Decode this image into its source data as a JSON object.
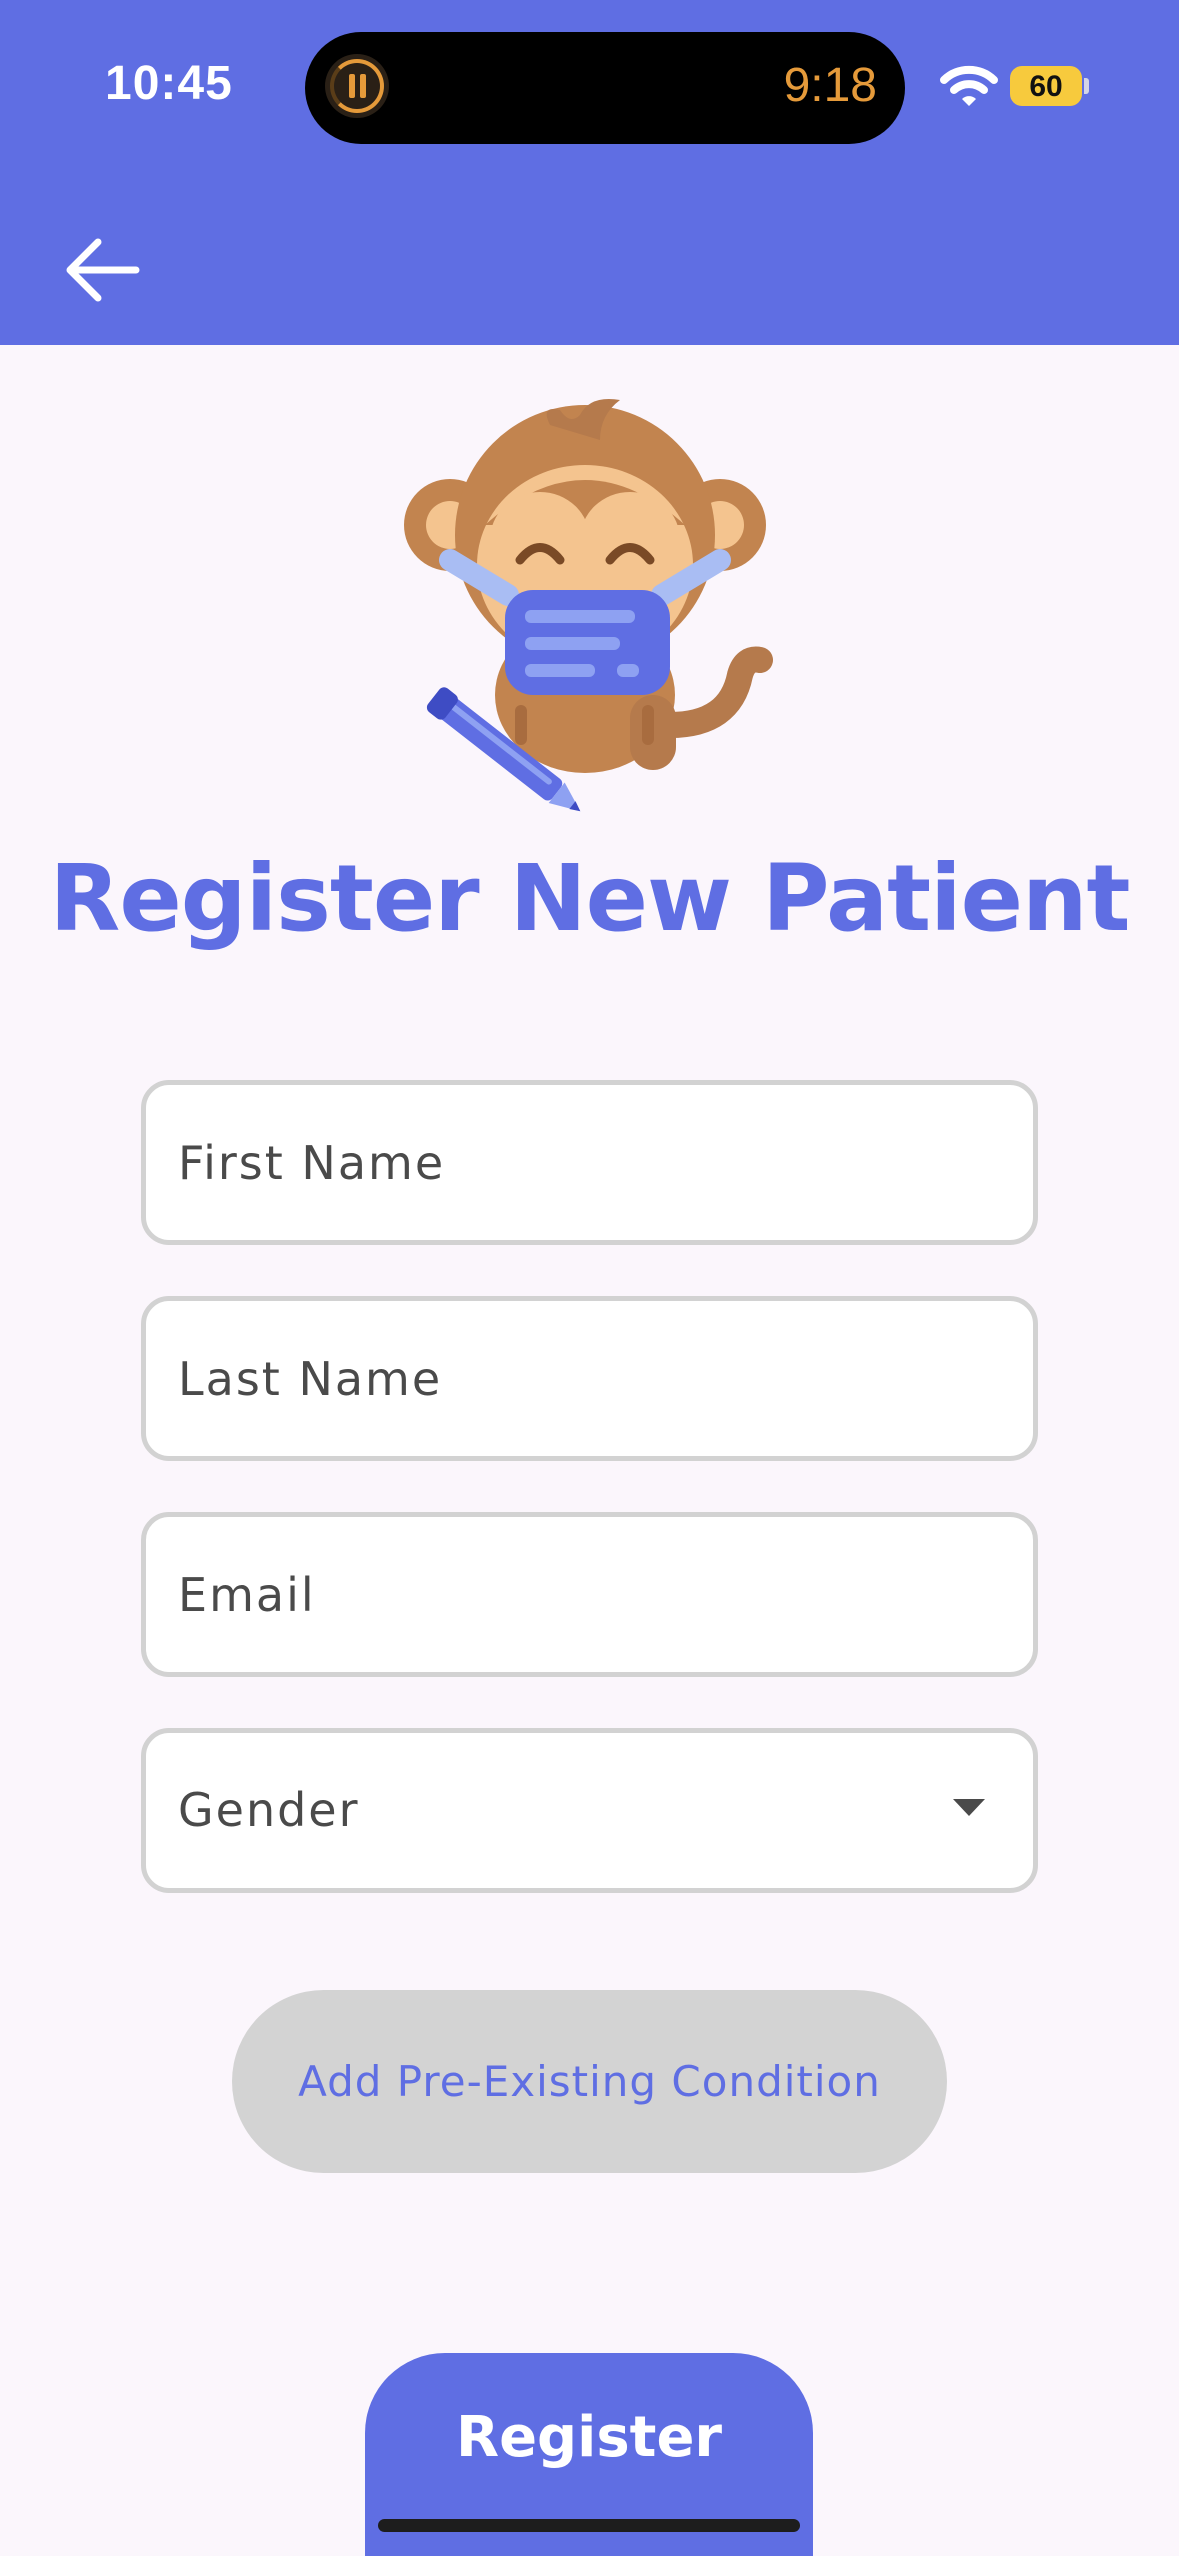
{
  "status_bar": {
    "time": "10:45",
    "timer": "9:18",
    "battery": "60"
  },
  "header": {
    "back_icon": "arrow-left-icon"
  },
  "illustration": {
    "icon": "monkey-with-mask-and-pencil"
  },
  "page": {
    "title": "Register New Patient"
  },
  "form": {
    "first_name_placeholder": "First Name",
    "last_name_placeholder": "Last Name",
    "email_placeholder": "Email",
    "gender_label": "Gender",
    "condition_button": "Add Pre-Existing Condition",
    "register_button": "Register"
  },
  "colors": {
    "primary": "#5f6ee3",
    "background": "#fbf6fc",
    "field_border": "#d2d2d2",
    "secondary_button": "#d3d3d3"
  }
}
